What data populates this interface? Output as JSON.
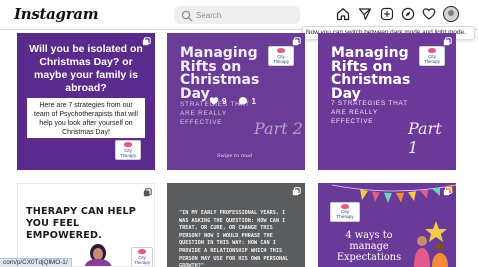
{
  "app": {
    "logo_text": "Instagram"
  },
  "search": {
    "placeholder": "Search",
    "icon": "search-icon"
  },
  "nav": {
    "icons": [
      "home-icon",
      "paper-plane-icon",
      "new-post-icon",
      "explore-compass-icon",
      "heart-icon",
      "profile-avatar"
    ]
  },
  "tooltip": {
    "text": "Now you can switch between dark mode and light mode."
  },
  "posts": [
    {
      "heading": "Will you be isolated on Christmas Day? or maybe your family is abroad?",
      "body": "Here are 7 strategies from our team of Psychotherapists that will help you look after yourself on Christmas Day!",
      "brand": "City Therapy",
      "type_icon": "carousel-icon"
    },
    {
      "title": "Managing Rifts on Christmas Day",
      "subtitle_lines": [
        "STRATEGIES THAT",
        "ARE REALLY",
        "EFFECTIVE"
      ],
      "part": "Part 2",
      "brand": "City Therapy",
      "signature": "Swipe to read",
      "likes": "9",
      "comments": "1",
      "type_icon": "carousel-icon"
    },
    {
      "title": "Managing Rifts on Christmas Day",
      "subtitle_lines": [
        "7 STRATEGIES THAT",
        "ARE REALLY",
        "EFFECTIVE"
      ],
      "part": "Part 1",
      "brand": "City Therapy",
      "type_icon": "carousel-icon"
    },
    {
      "heading": "THERAPY CAN HELP YOU FEEL EMPOWERED.",
      "brand": "City Therapy",
      "type_icon": "carousel-icon"
    },
    {
      "quote": "\"IN MY EARLY PROFESSIONAL YEARS, I WAS ASKING THE QUESTION: HOW CAN I TREAT, OR CURE, OR CHANGE THIS PERSON? NOW I WOULD PHRASE THE QUESTION IN THIS WAY: HOW CAN I PROVIDE A RELATIONSHIP WHICH THIS PERSON MAY USE FOR HIS OWN PERSONAL GROWTH?\"",
      "type_icon": "carousel-icon"
    },
    {
      "heading": "4 ways to manage Expectations",
      "brand": "City Therapy",
      "type_icon": "carousel-icon"
    }
  ],
  "status_bar": {
    "url": "com/p/CX0TdjQlMO-1/"
  },
  "colors": {
    "post_purple": "#5a2a8c",
    "post_purple_light": "#6c3999",
    "post_gray": "#5b5c5e",
    "accent_pink": "#e25b8b"
  }
}
